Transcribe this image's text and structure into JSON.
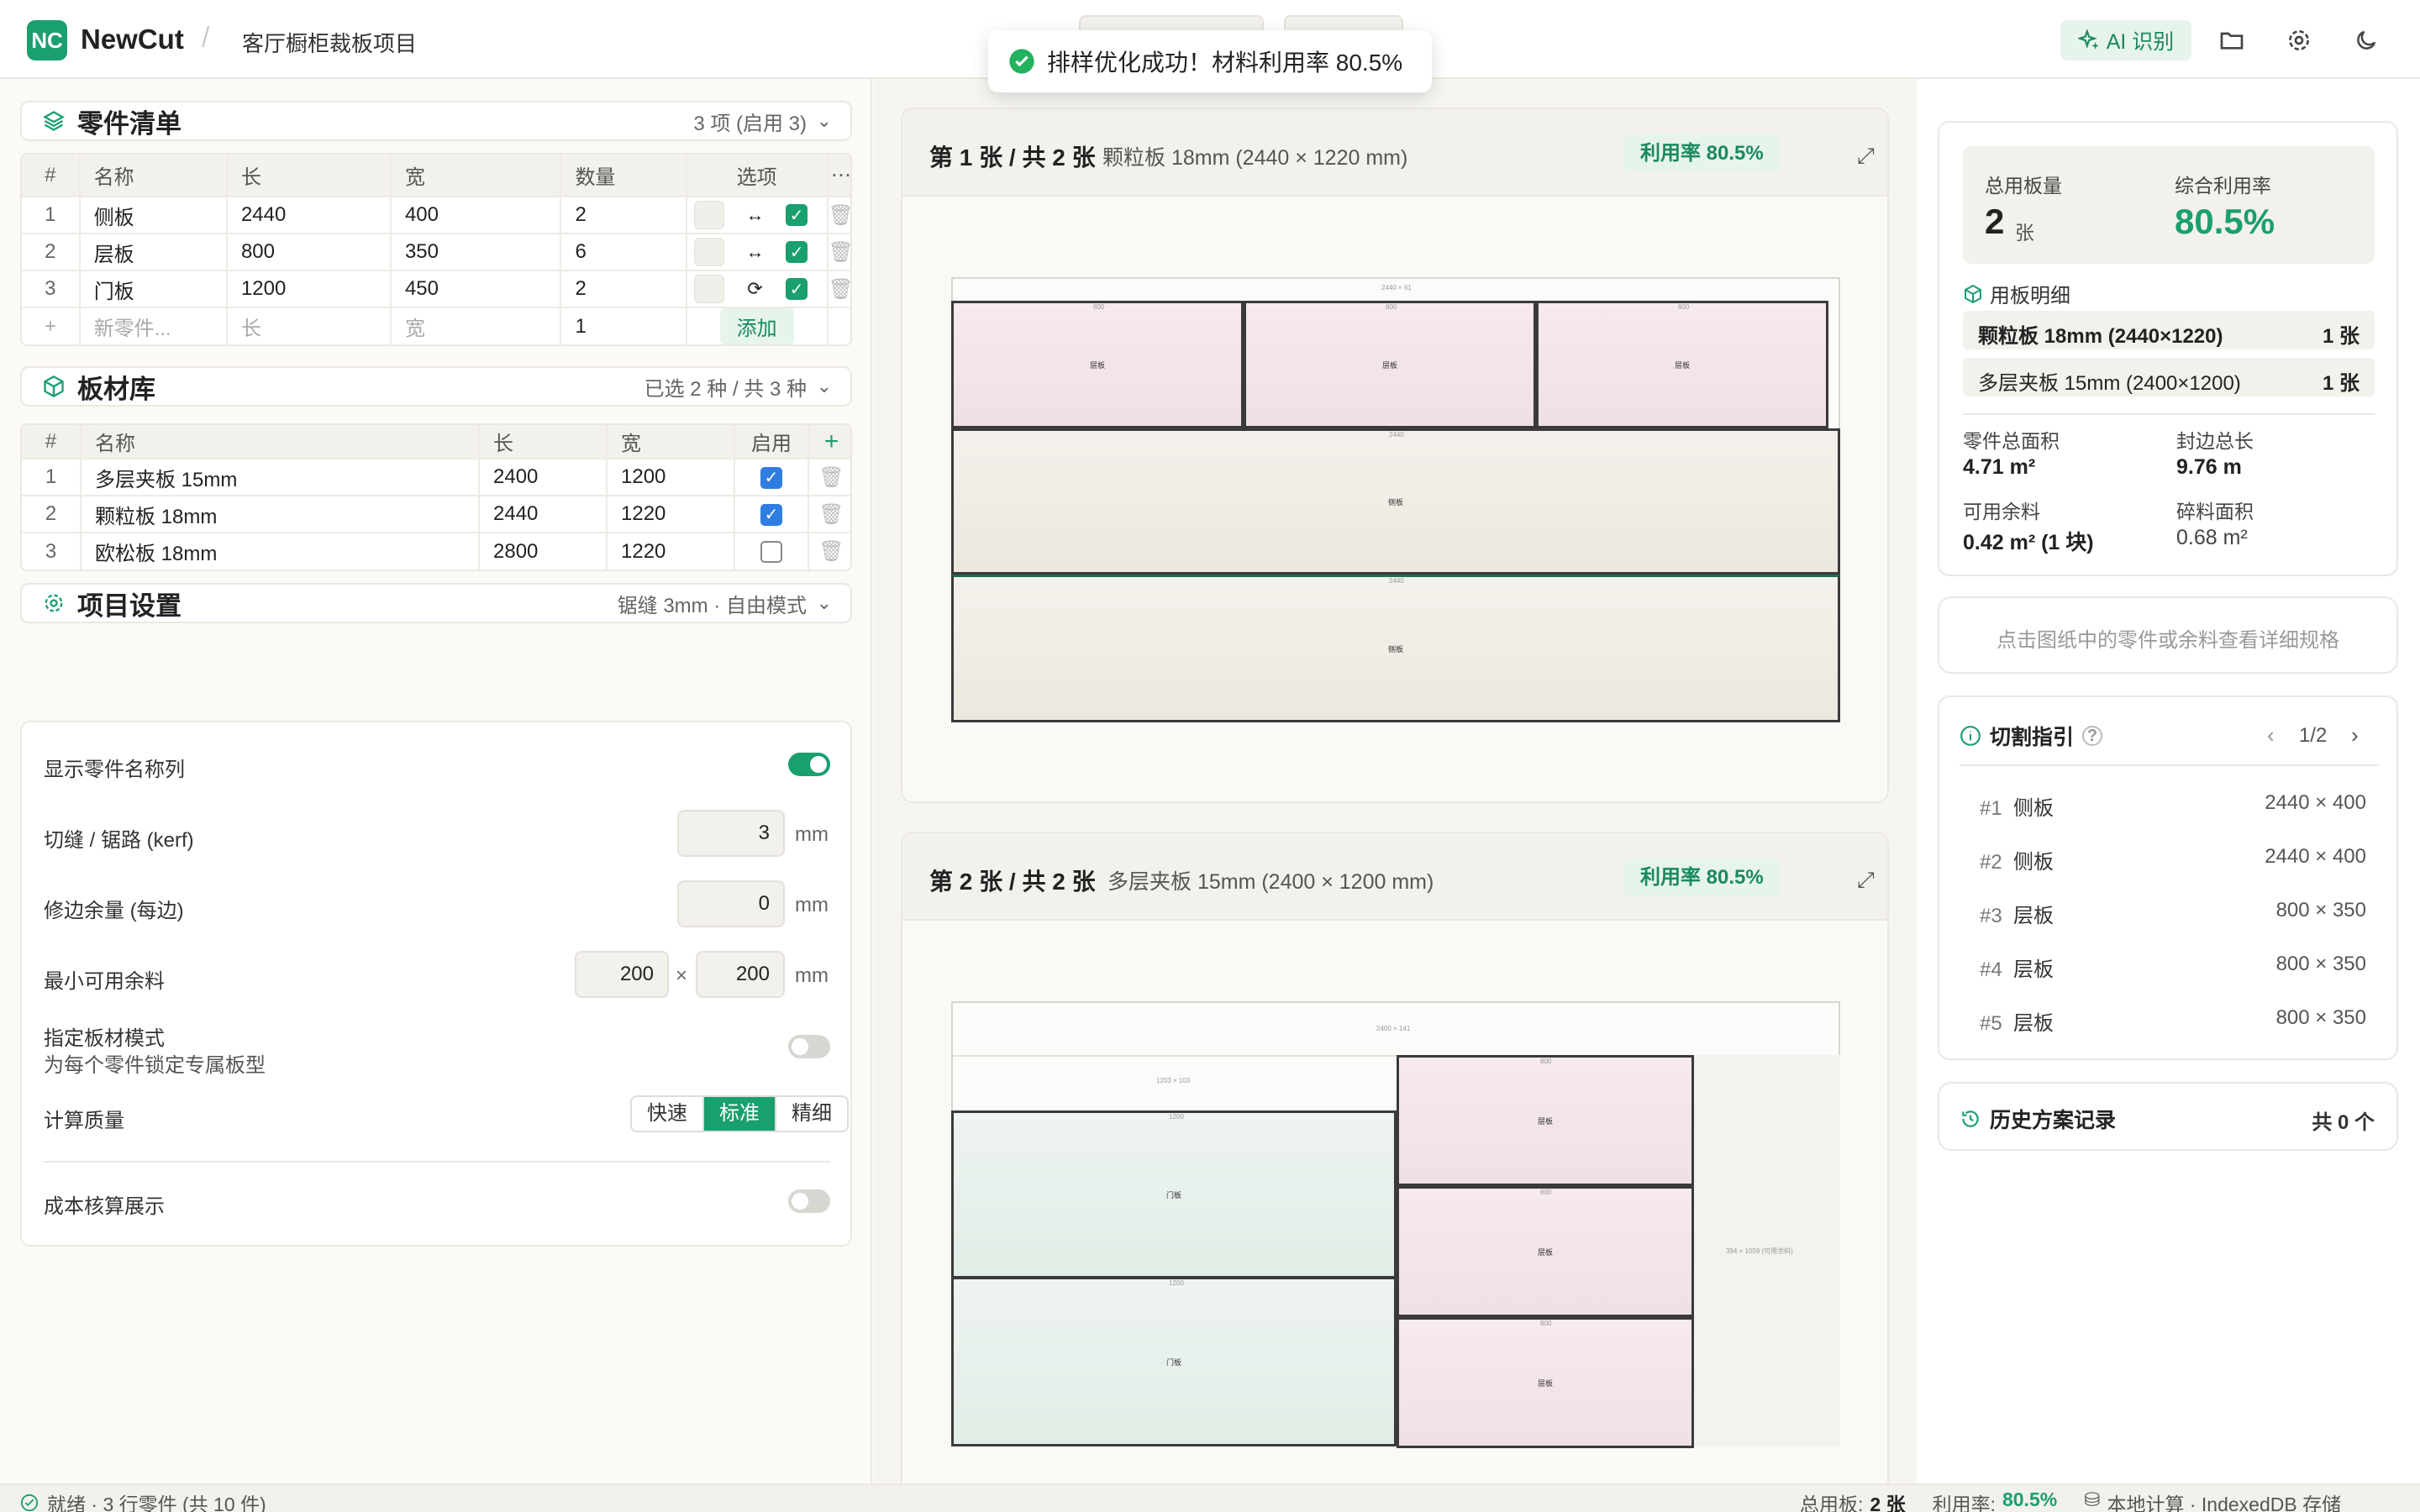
{
  "header": {
    "logo": "NC",
    "brand": "NewCut",
    "project": "客厅橱柜裁板项目",
    "ai_button": "AI 识别"
  },
  "toast": {
    "message": "排样优化成功！材料利用率 80.5%"
  },
  "parts": {
    "title": "零件清单",
    "meta": "3 项 (启用 3)",
    "columns": [
      "#",
      "名称",
      "长",
      "宽",
      "数量",
      "选项"
    ],
    "rows": [
      {
        "idx": "1",
        "name": "侧板",
        "length": "2440",
        "width": "400",
        "qty": "2",
        "grain": "↔"
      },
      {
        "idx": "2",
        "name": "层板",
        "length": "800",
        "width": "350",
        "qty": "6",
        "grain": "↔"
      },
      {
        "idx": "3",
        "name": "门板",
        "length": "1200",
        "width": "450",
        "qty": "2",
        "grain": "⟳"
      }
    ],
    "new_row": {
      "idx": "+",
      "name_placeholder": "新零件...",
      "length_placeholder": "长",
      "width_placeholder": "宽",
      "qty": "1",
      "add_label": "添加"
    }
  },
  "materials": {
    "title": "板材库",
    "meta": "已选 2 种 / 共 3 种",
    "columns": [
      "#",
      "名称",
      "长",
      "宽",
      "启用"
    ],
    "rows": [
      {
        "idx": "1",
        "name": "多层夹板 15mm",
        "length": "2400",
        "width": "1200",
        "enabled": true
      },
      {
        "idx": "2",
        "name": "颗粒板 18mm",
        "length": "2440",
        "width": "1220",
        "enabled": true
      },
      {
        "idx": "3",
        "name": "欧松板 18mm",
        "length": "2800",
        "width": "1220",
        "enabled": false
      }
    ]
  },
  "settings": {
    "title": "项目设置",
    "meta": "锯缝 3mm · 自由模式",
    "show_names_label": "显示零件名称列",
    "kerf_label": "切缝 / 锯路 (kerf)",
    "kerf_value": "3",
    "trim_label": "修边余量 (每边)",
    "trim_value": "0",
    "min_remnant_label": "最小可用余料",
    "min_remnant_w": "200",
    "min_remnant_h": "200",
    "times": "×",
    "unit": "mm",
    "fixed_board_label": "指定板材模式",
    "fixed_board_desc": "为每个零件锁定专属板型",
    "quality_label": "计算质量",
    "quality_options": [
      "快速",
      "标准",
      "精细"
    ],
    "cost_label": "成本核算展示"
  },
  "sheets": [
    {
      "title": "第 1 张 / 共 2 张",
      "subtitle": "颗粒板 18mm (2440 × 1220 mm)",
      "util": "利用率 80.5%",
      "board_label": "2440 × 61",
      "parts": [
        {
          "label": "层板",
          "dim": "800"
        },
        {
          "label": "层板",
          "dim": "800"
        },
        {
          "label": "层板",
          "dim": "800"
        },
        {
          "label": "侧板",
          "dim": "2440"
        },
        {
          "label": "侧板",
          "dim": "2440"
        }
      ]
    },
    {
      "title": "第 2 张 / 共 2 张",
      "subtitle": "多层夹板 15mm (2400 × 1200 mm)",
      "util": "利用率 80.5%",
      "board_label": "2400 × 141",
      "remnant_top": "1203 × 103",
      "remnant_right": "394 × 1059 (可用余料)",
      "parts": [
        {
          "label": "门板",
          "dim": "1200"
        },
        {
          "label": "门板",
          "dim": "1200"
        },
        {
          "label": "层板",
          "dim": "800"
        },
        {
          "label": "层板",
          "dim": "800"
        },
        {
          "label": "层板",
          "dim": "800"
        }
      ]
    }
  ],
  "summary": {
    "total_boards_label": "总用板量",
    "total_boards_value": "2",
    "total_boards_unit": "张",
    "util_label": "综合利用率",
    "util_value": "80.5%",
    "materials_title": "用板明细",
    "materials": [
      {
        "name": "颗粒板 18mm (2440×1220)",
        "count": "1 张"
      },
      {
        "name": "多层夹板 15mm (2400×1200)",
        "count": "1 张"
      }
    ],
    "area_label": "零件总面积",
    "area_value": "4.71 m²",
    "edge_label": "封边总长",
    "edge_value": "9.76 m",
    "remnant_label": "可用余料",
    "remnant_value": "0.42 m² (1 块)",
    "scrap_label": "碎料面积",
    "scrap_value": "0.68 m²"
  },
  "hint": "点击图纸中的零件或余料查看详细规格",
  "guide": {
    "title": "切割指引",
    "page": "1/2",
    "rows": [
      {
        "n": "#1",
        "name": "侧板",
        "dim": "2440 × 400"
      },
      {
        "n": "#2",
        "name": "侧板",
        "dim": "2440 × 400"
      },
      {
        "n": "#3",
        "name": "层板",
        "dim": "800 × 350"
      },
      {
        "n": "#4",
        "name": "层板",
        "dim": "800 × 350"
      },
      {
        "n": "#5",
        "name": "层板",
        "dim": "800 × 350"
      }
    ]
  },
  "history": {
    "title": "历史方案记录",
    "count": "共 0 个"
  },
  "status": {
    "ready": "就绪 · 3 行零件 (共 10 件)",
    "boards_label": "总用板:",
    "boards_value": "2 张",
    "util_label": "利用率:",
    "util_value": "80.5%",
    "storage": "本地计算 · IndexedDB 存储"
  },
  "colors": {
    "accent": "#1a9f6e",
    "accent_light": "#e6f4ec"
  }
}
